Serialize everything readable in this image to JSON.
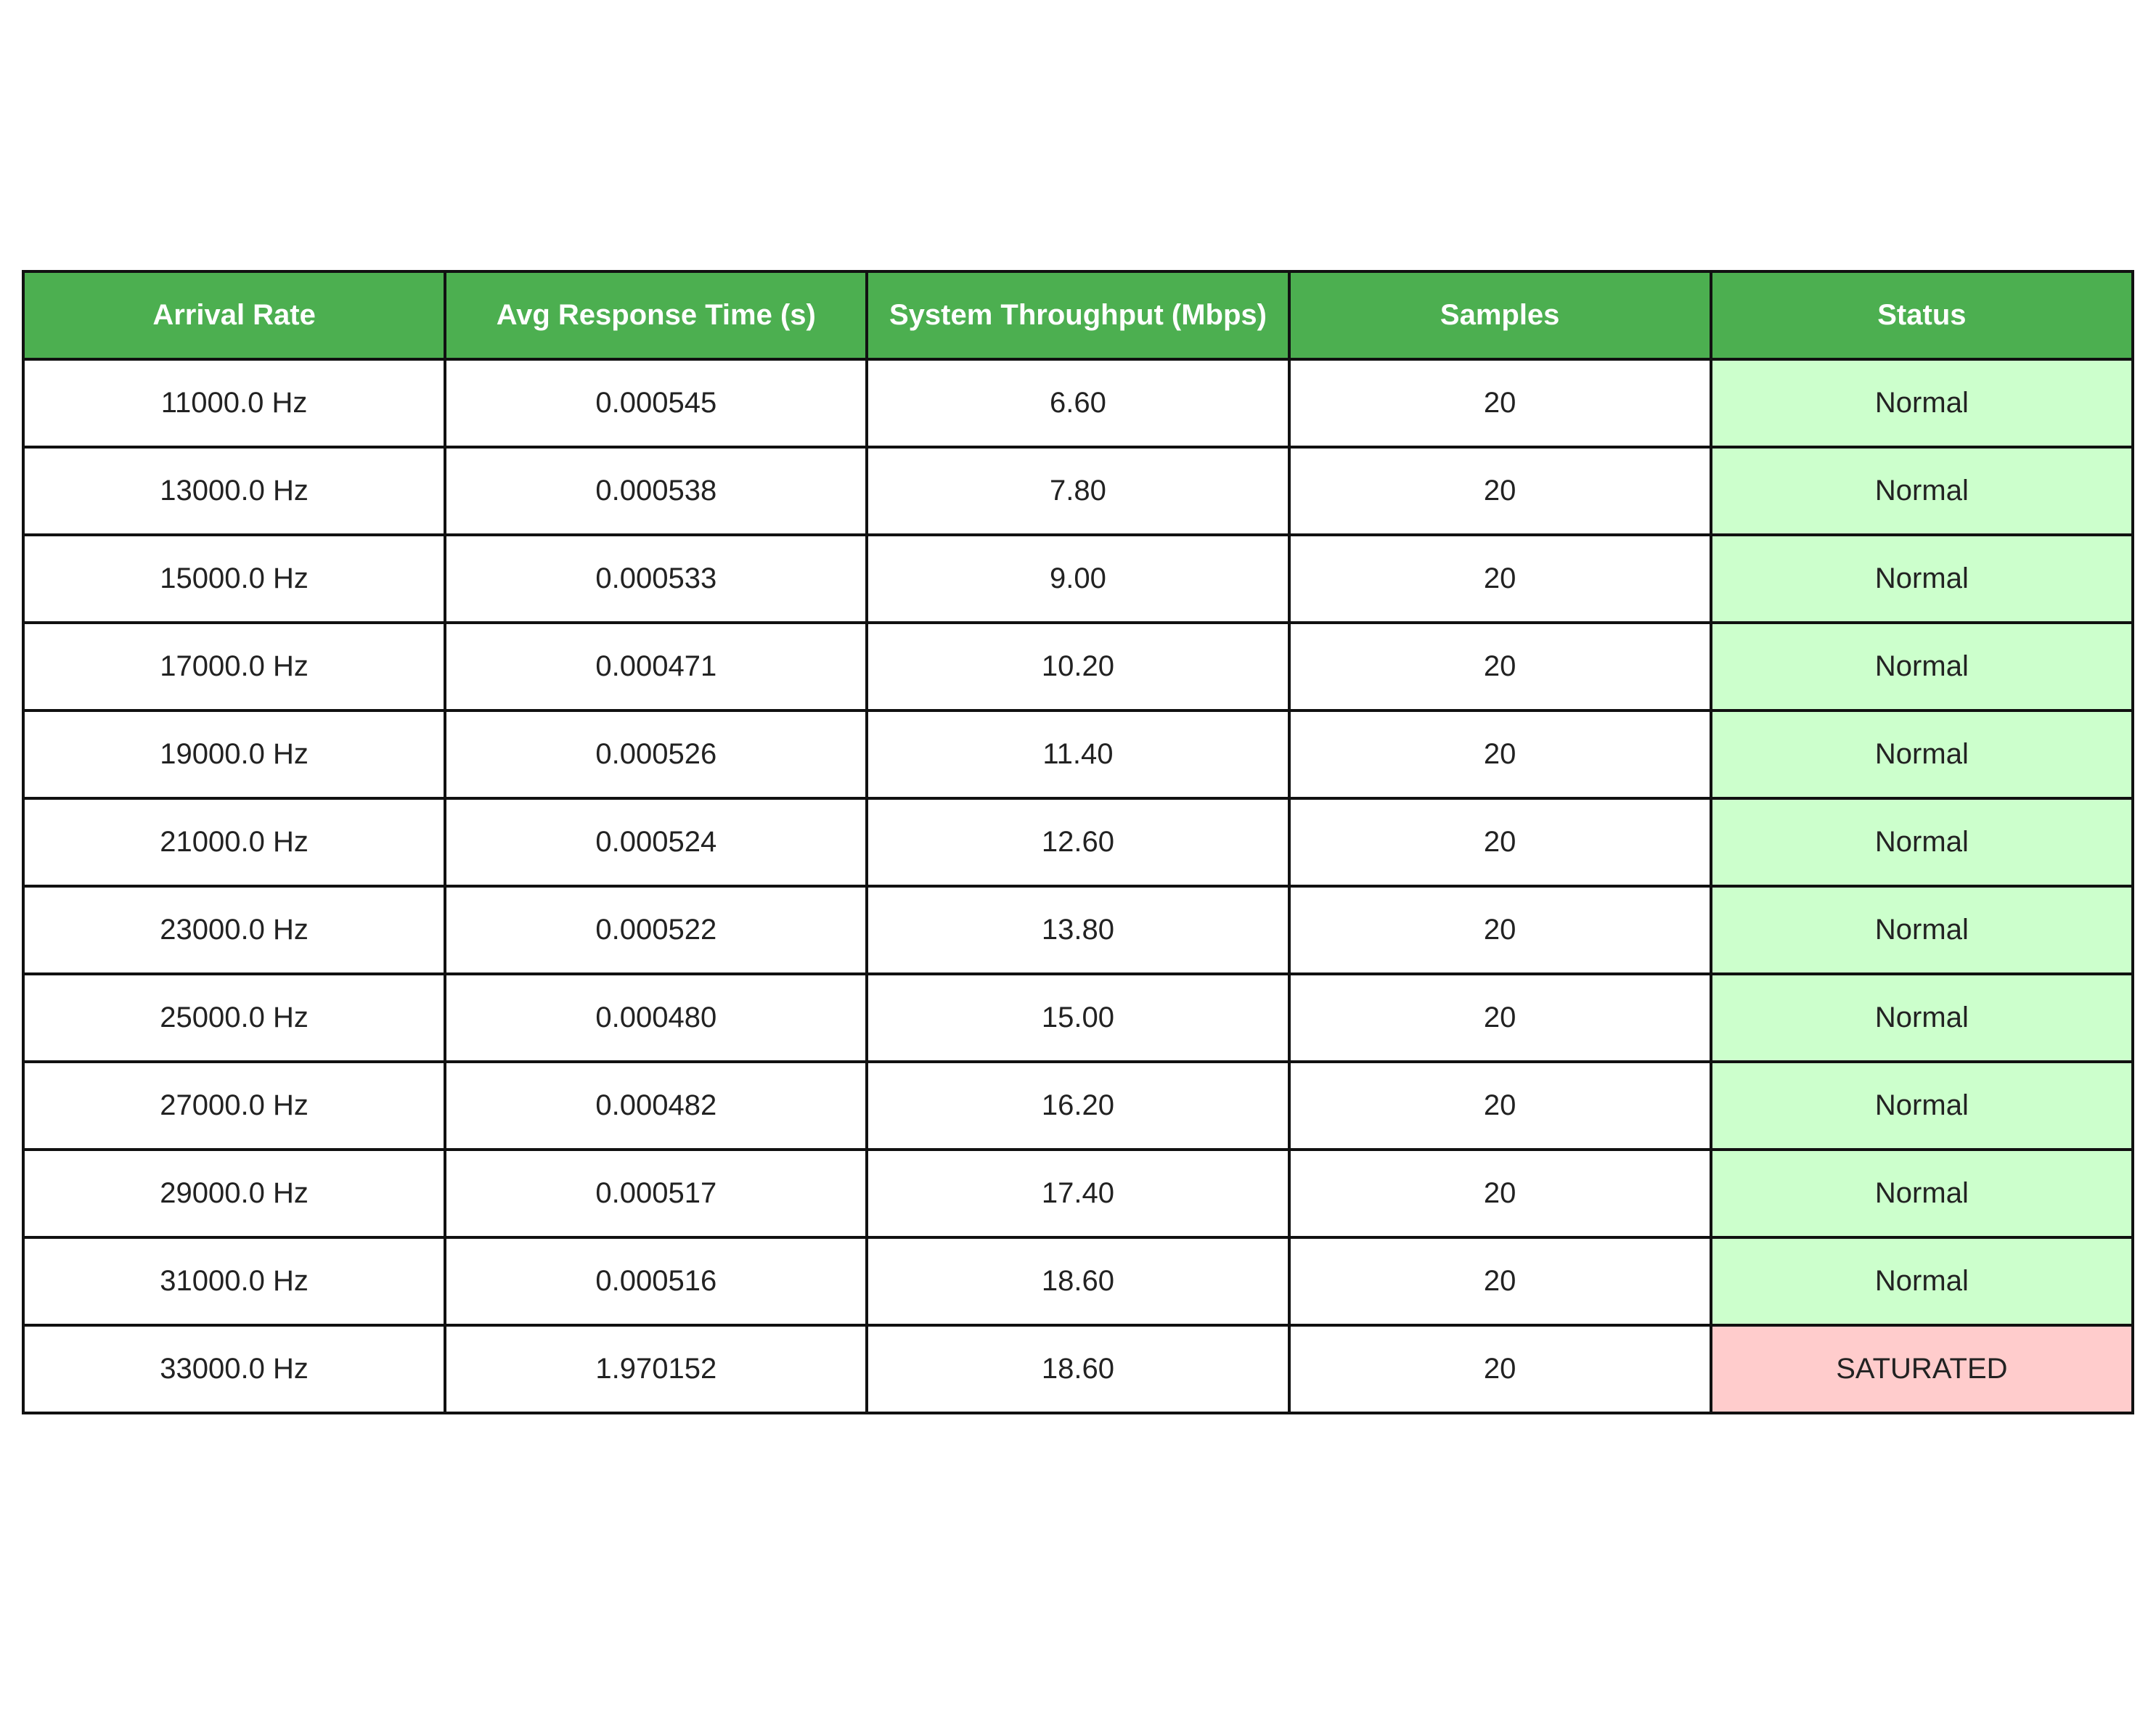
{
  "chart_data": {
    "type": "table",
    "columns": [
      "Arrival Rate",
      "Avg Response Time (s)",
      "System Throughput (Mbps)",
      "Samples",
      "Status"
    ],
    "rows": [
      [
        "11000.0 Hz",
        "0.000545",
        "6.60",
        "20",
        "Normal"
      ],
      [
        "13000.0 Hz",
        "0.000538",
        "7.80",
        "20",
        "Normal"
      ],
      [
        "15000.0 Hz",
        "0.000533",
        "9.00",
        "20",
        "Normal"
      ],
      [
        "17000.0 Hz",
        "0.000471",
        "10.20",
        "20",
        "Normal"
      ],
      [
        "19000.0 Hz",
        "0.000526",
        "11.40",
        "20",
        "Normal"
      ],
      [
        "21000.0 Hz",
        "0.000524",
        "12.60",
        "20",
        "Normal"
      ],
      [
        "23000.0 Hz",
        "0.000522",
        "13.80",
        "20",
        "Normal"
      ],
      [
        "25000.0 Hz",
        "0.000480",
        "15.00",
        "20",
        "Normal"
      ],
      [
        "27000.0 Hz",
        "0.000482",
        "16.20",
        "20",
        "Normal"
      ],
      [
        "29000.0 Hz",
        "0.000517",
        "17.40",
        "20",
        "Normal"
      ],
      [
        "31000.0 Hz",
        "0.000516",
        "18.60",
        "20",
        "Normal"
      ],
      [
        "33000.0 Hz",
        "1.970152",
        "18.60",
        "20",
        "SATURATED"
      ]
    ]
  },
  "colors": {
    "header_bg": "#4caf50",
    "header_text": "#ffffff",
    "status_normal_bg": "#ccffcc",
    "status_saturated_bg": "#ffcccc",
    "border": "#111111",
    "text": "#222222"
  }
}
